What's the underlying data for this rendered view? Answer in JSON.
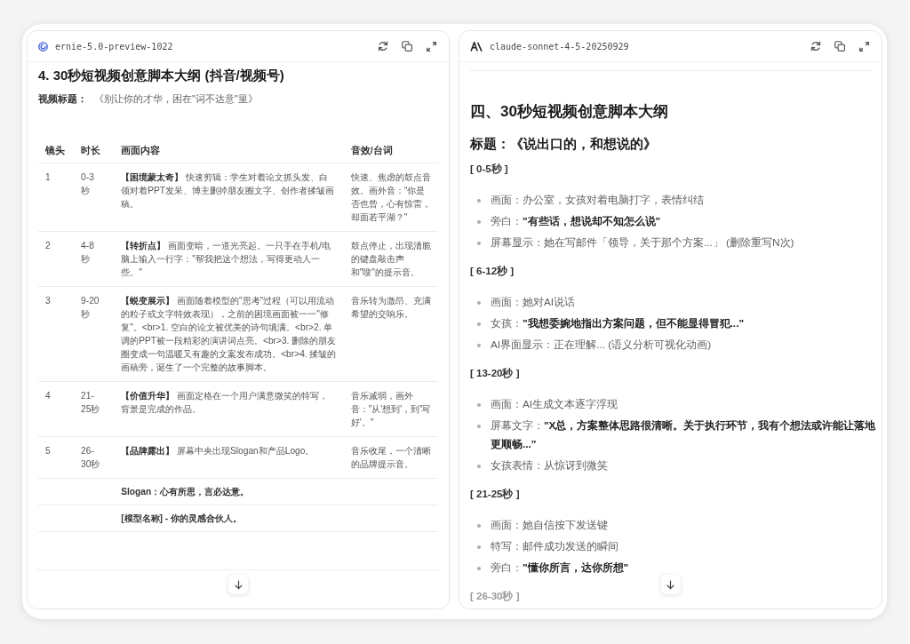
{
  "left_panel": {
    "model_name": "ernie-5.0-preview-1022",
    "heading": "4. 30秒短视频创意脚本大纲 (抖音/视频号)",
    "video_title": {
      "label": "视频标题：",
      "value": "《别让你的才华，困在\"词不达意\"里》"
    },
    "table": {
      "columns": [
        "镜头",
        "时长",
        "画面内容",
        "音效/台词"
      ],
      "rows": [
        {
          "kind": "shot",
          "cells": [
            "1",
            "0-3秒",
            "**【困境蒙太奇】** 快速剪辑：学生对着论文抓头发、白领对着PPT发呆、博主删掉朋友圈文字、创作者揉皱画稿。",
            "快速、焦虑的鼓点音效。画外音：\"你是否也曾，心有惊雷，却面若平湖？\""
          ]
        },
        {
          "kind": "shot",
          "cells": [
            "2",
            "4-8秒",
            "**【转折点】** 画面变暗，一道光亮起。一只手在手机/电脑上输入一行字：\"帮我把这个想法，写得更动人一些。\"",
            "鼓点停止，出现清脆的键盘敲击声和\"嗖\"的提示音。"
          ]
        },
        {
          "kind": "shot",
          "cells": [
            "3",
            "9-20秒",
            "**【蜕变展示】** 画面随着模型的\"思考\"过程（可以用流动的粒子或文字特效表现），之前的困境画面被一一\"修复\"。<br>1. 空白的论文被优美的诗句填满。<br>2. 单调的PPT被一段精彩的演讲词点亮。<br>3. 删除的朋友圈变成一句温暖又有趣的文案发布成功。<br>4. 揉皱的画稿旁，诞生了一个完整的故事脚本。",
            "音乐转为激昂、充满希望的交响乐。"
          ]
        },
        {
          "kind": "shot",
          "cells": [
            "4",
            "21-25秒",
            "**【价值升华】** 画面定格在一个用户满意微笑的特写，背景是完成的作品。",
            "音乐减弱，画外音：\"从'想到'，到'写好'。\""
          ]
        },
        {
          "kind": "shot",
          "cells": [
            "5",
            "26-30秒",
            "**【品牌露出】** 屏幕中央出现Slogan和产品Logo。",
            "音乐收尾，一个清晰的品牌提示音。"
          ]
        },
        {
          "kind": "note",
          "text": "Slogan：心有所思，言必达意。"
        },
        {
          "kind": "note",
          "text": "[模型名称] - 你的灵感合伙人。"
        }
      ]
    }
  },
  "right_panel": {
    "model_name": "claude-sonnet-4-5-20250929",
    "heading": "四、30秒短视频创意脚本大纲",
    "subheading": "标题：《说出口的，和想说的》",
    "sections": [
      {
        "label": "[ 0-5秒 ]",
        "faded": false,
        "items": [
          "画面：办公室，女孩对着电脑打字，表情纠结",
          "旁白：**\"有些话，想说却不知怎么说\"**",
          "屏幕显示：她在写邮件「领导，关于那个方案...」 (删除重写N次)"
        ]
      },
      {
        "label": "[ 6-12秒 ]",
        "faded": false,
        "items": [
          "画面：她对AI说话",
          "女孩：**\"我想委婉地指出方案问题，但不能显得冒犯...\"**",
          "AI界面显示：正在理解... (语义分析可视化动画)"
        ]
      },
      {
        "label": "[ 13-20秒 ]",
        "faded": false,
        "items": [
          "画面：AI生成文本逐字浮现",
          "屏幕文字：**\"X总，方案整体思路很清晰。关于执行环节，我有个想法或许能让落地更顺畅...\"**",
          "女孩表情：从惊讶到微笑"
        ]
      },
      {
        "label": "[ 21-25秒 ]",
        "faded": false,
        "items": [
          "画面：她自信按下发送键",
          "特写：邮件成功发送的瞬间",
          "旁白：**\"懂你所言，达你所想\"**"
        ]
      },
      {
        "label": "[ 26-30秒 ]",
        "faded": true
      }
    ]
  }
}
